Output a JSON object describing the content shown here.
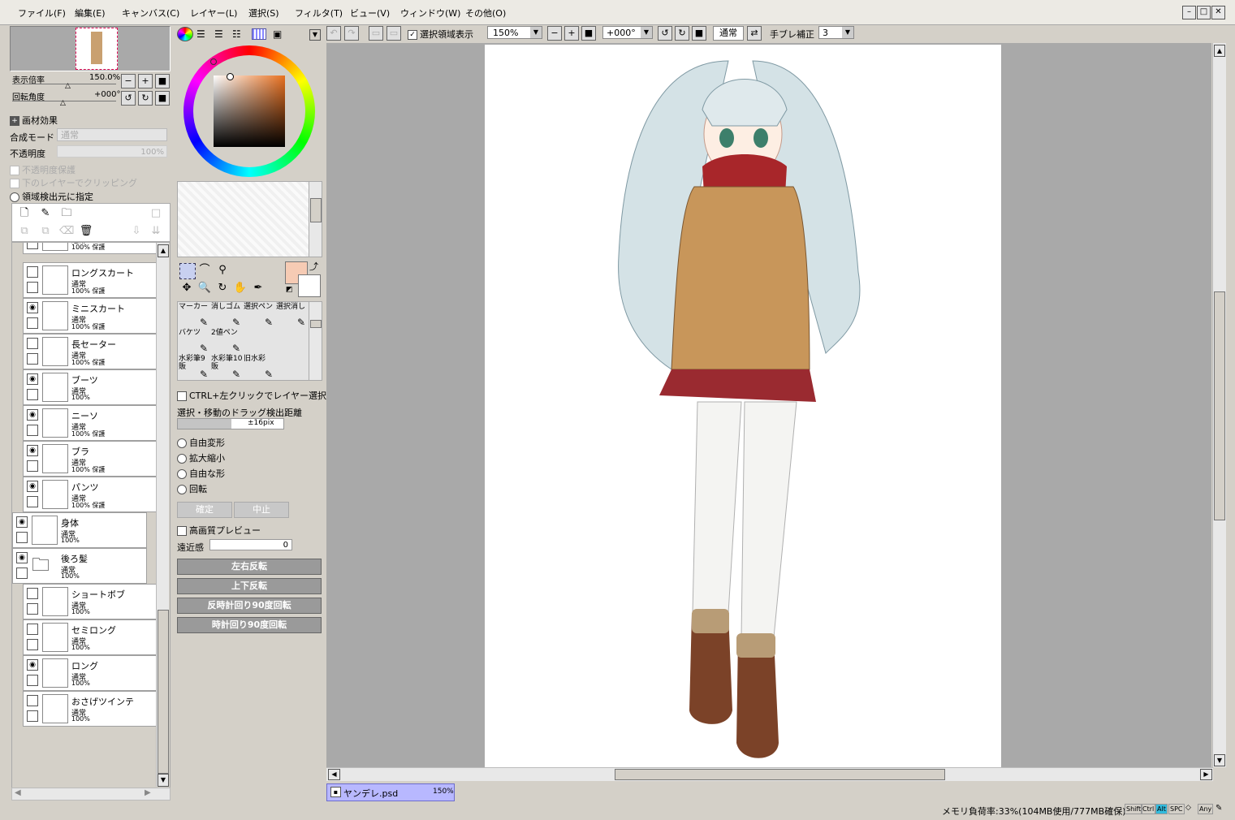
{
  "menu": [
    "ファイル(F)",
    "編集(E)",
    "キャンバス(C)",
    "レイヤー(L)",
    "選択(S)",
    "フィルタ(T)",
    "ビュー(V)",
    "ウィンドウ(W)",
    "その他(O)"
  ],
  "navigator": {
    "zoom_label": "表示倍率",
    "zoom_value": "150.0%",
    "rotate_label": "回転角度",
    "rotate_value": "+000°"
  },
  "layer_props": {
    "texture_label": "画材効果",
    "blend_label": "合成モード",
    "blend_value": "通常",
    "opacity_label": "不透明度",
    "opacity_value": "100%",
    "protect_label": "不透明度保護",
    "clip_label": "下のレイヤーでクリッピング",
    "detect_label": "領域検出元に指定"
  },
  "layers": [
    {
      "name": "",
      "mode": "通常",
      "opacity": "100% 保護",
      "visible": false
    },
    {
      "name": "ロングスカート",
      "mode": "通常",
      "opacity": "100% 保護",
      "visible": false
    },
    {
      "name": "ミニスカート",
      "mode": "通常",
      "opacity": "100% 保護",
      "visible": true
    },
    {
      "name": "長セーター",
      "mode": "通常",
      "opacity": "100% 保護",
      "visible": false
    },
    {
      "name": "ブーツ",
      "mode": "通常",
      "opacity": "100%",
      "visible": true
    },
    {
      "name": "ニーソ",
      "mode": "通常",
      "opacity": "100% 保護",
      "visible": true
    },
    {
      "name": "ブラ",
      "mode": "通常",
      "opacity": "100% 保護",
      "visible": true
    },
    {
      "name": "パンツ",
      "mode": "通常",
      "opacity": "100% 保護",
      "visible": true
    },
    {
      "name": "身体",
      "mode": "通常",
      "opacity": "100%",
      "visible": true
    },
    {
      "name": "後ろ髪",
      "mode": "通常",
      "opacity": "100%",
      "visible": true
    },
    {
      "name": "ショートボブ",
      "mode": "通常",
      "opacity": "100%",
      "visible": false
    },
    {
      "name": "セミロング",
      "mode": "通常",
      "opacity": "100%",
      "visible": false
    },
    {
      "name": "ロング",
      "mode": "通常",
      "opacity": "100%",
      "visible": true
    },
    {
      "name": "おさげツインテ",
      "mode": "通常",
      "opacity": "100%",
      "visible": false
    }
  ],
  "colors": {
    "primary": "#f6cbb4",
    "secondary": "#ffffff",
    "accent_tab": "#b8b8ff",
    "canvas_bg": "#a9a9a9"
  },
  "brushes": [
    {
      "label": "マーカー"
    },
    {
      "label": "消しゴム"
    },
    {
      "label": "選択ペン"
    },
    {
      "label": "選択消し"
    },
    {
      "label": "バケツ"
    },
    {
      "label": "2値ペン"
    },
    {
      "label": ""
    },
    {
      "label": ""
    },
    {
      "label": "水彩筆9販"
    },
    {
      "label": "水彩筆10販"
    },
    {
      "label": "旧水彩"
    },
    {
      "label": ""
    }
  ],
  "tool_options": {
    "ctrl_click": "CTRL+左クリックでレイヤー選択",
    "drag_label": "選択・移動のドラッグ検出距離",
    "drag_value": "±16pix",
    "modes": [
      "自由変形",
      "拡大縮小",
      "自由な形",
      "回転"
    ],
    "ok": "確定",
    "cancel": "中止",
    "hq_preview": "高画質プレビュー",
    "perspective_label": "遠近感",
    "perspective_value": "0",
    "flip_h": "左右反転",
    "flip_v": "上下反転",
    "rot_ccw": "反時計回り90度回転",
    "rot_cw": "時計回り90度回転"
  },
  "toolbar": {
    "show_selection": "選択領域表示",
    "zoom": "150%",
    "angle": "+000°",
    "blend": "通常",
    "stabilizer_label": "手ブレ補正",
    "stabilizer_value": "3"
  },
  "doc_tab": {
    "name": "ヤンデレ.psd",
    "zoom": "150%"
  },
  "status": {
    "memory": "メモリ負荷率:33%(104MB使用/777MB確保)",
    "keys": [
      "Shift",
      "Ctrl",
      "Alt",
      "SPC",
      "◇",
      "Any"
    ]
  }
}
